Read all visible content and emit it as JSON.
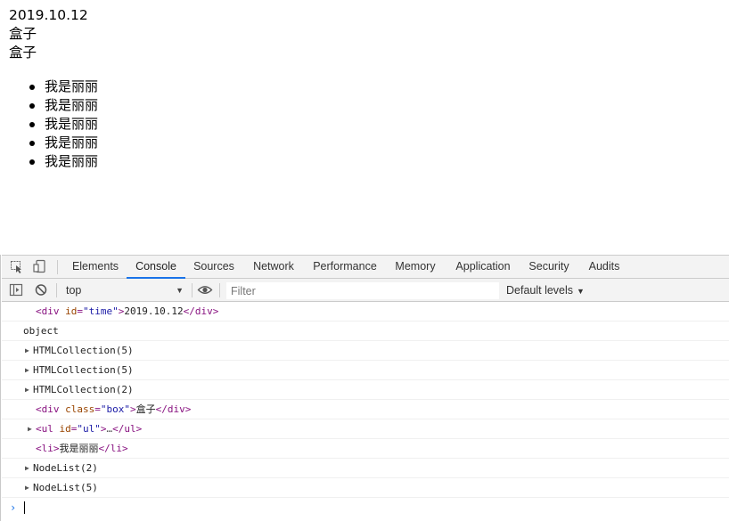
{
  "page": {
    "lines": [
      "2019.10.12",
      "盒子",
      "盒子"
    ],
    "list_items": [
      "我是丽丽",
      "我是丽丽",
      "我是丽丽",
      "我是丽丽",
      "我是丽丽"
    ]
  },
  "devtools": {
    "tabs": [
      {
        "label": "Elements",
        "active": false
      },
      {
        "label": "Console",
        "active": true
      },
      {
        "label": "Sources",
        "active": false
      },
      {
        "label": "Network",
        "active": false
      },
      {
        "label": "Performance",
        "active": false
      },
      {
        "label": "Memory",
        "active": false
      },
      {
        "label": "Application",
        "active": false
      },
      {
        "label": "Security",
        "active": false
      },
      {
        "label": "Audits",
        "active": false
      }
    ],
    "toolbar": {
      "context": "top",
      "filter_placeholder": "Filter",
      "levels_label": "Default levels"
    },
    "console": {
      "msg1": {
        "open": "<div",
        "attr": "id",
        "eq": "=",
        "val": "\"time\"",
        "close": ">",
        "text": "2019.10.12",
        "end": "</div>"
      },
      "msg2": "object",
      "msg3": "HTMLCollection(5)",
      "msg4": "HTMLCollection(5)",
      "msg5": "HTMLCollection(2)",
      "msg6": {
        "open": "<div",
        "attr": "class",
        "eq": "=",
        "val": "\"box\"",
        "close": ">",
        "text": "盒子",
        "end": "</div>"
      },
      "msg7": {
        "open": "<ul",
        "attr": "id",
        "eq": "=",
        "val": "\"ul\"",
        "close": ">",
        "text": "…",
        "end": "</ul>"
      },
      "msg8": {
        "open": "<li>",
        "text": "我是丽丽",
        "end": "</li>"
      },
      "msg9": "NodeList(2)",
      "msg10": "NodeList(5)"
    },
    "colors": {
      "accent": "#1a73e8",
      "tag": "#881280",
      "attr_name": "#994500",
      "attr_value": "#1a1aa6"
    }
  }
}
